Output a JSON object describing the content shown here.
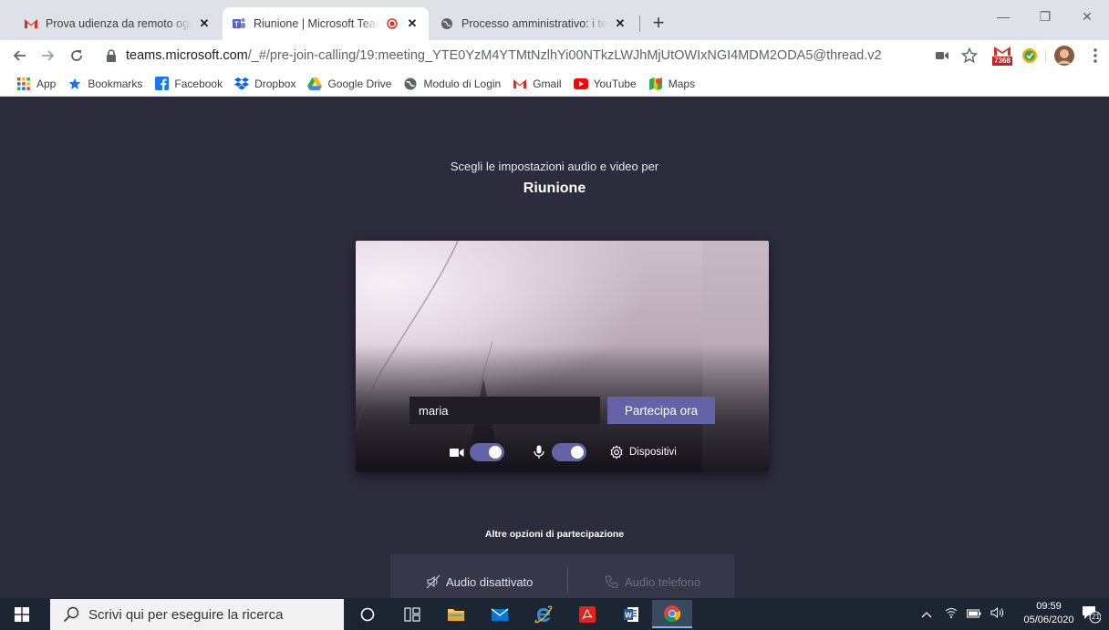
{
  "browser": {
    "tabs": [
      {
        "title": "Prova udienza da remoto oggi o",
        "close": "✕",
        "icon": "gmail-icon"
      },
      {
        "title": "Riunione | Microsoft Teams",
        "close": "✕",
        "icon": "teams-icon",
        "recording": true
      },
      {
        "title": "Processo amministrativo: i termin",
        "close": "✕",
        "icon": "globe-icon"
      }
    ],
    "new_tab": "+",
    "window_controls": {
      "minimize": "—",
      "maximize": "❐",
      "close": "✕"
    },
    "url_host": "teams.microsoft.com",
    "url_path": "/_#/pre-join-calling/19:meeting_YTE0YzM4YTMtNzlhYi00NTkzLWJhMjUtOWIxNGI4MDM2ODA5@thread.v2",
    "gmail_badge": "7368",
    "bookmarks": [
      {
        "label": "App",
        "icon": "apps-grid-icon"
      },
      {
        "label": "Bookmarks",
        "icon": "star-icon"
      },
      {
        "label": "Facebook",
        "icon": "facebook-icon"
      },
      {
        "label": "Dropbox",
        "icon": "dropbox-icon"
      },
      {
        "label": "Google Drive",
        "icon": "google-drive-icon"
      },
      {
        "label": "Modulo di Login",
        "icon": "globe-icon"
      },
      {
        "label": "Gmail",
        "icon": "gmail-icon"
      },
      {
        "label": "YouTube",
        "icon": "youtube-icon"
      },
      {
        "label": "Maps",
        "icon": "maps-icon"
      }
    ]
  },
  "prejoin": {
    "subtitle": "Scegli le impostazioni audio e video per",
    "meeting_title": "Riunione",
    "name_value": "maria",
    "join_label": "Partecipa ora",
    "camera_on": true,
    "mic_on": true,
    "devices_label": "Dispositivi",
    "more_options_title": "Altre opzioni di partecipazione",
    "audio_off_label": "Audio disattivato",
    "phone_audio_label": "Audio telefono"
  },
  "colors": {
    "teams_purple": "#6264a7",
    "page_bg": "#2d2c3c",
    "taskbar_bg": "#1c2633"
  },
  "taskbar": {
    "search_placeholder": "Scrivi qui per eseguire la ricerca",
    "time": "09:59",
    "date": "05/06/2020",
    "notifications": "21"
  }
}
